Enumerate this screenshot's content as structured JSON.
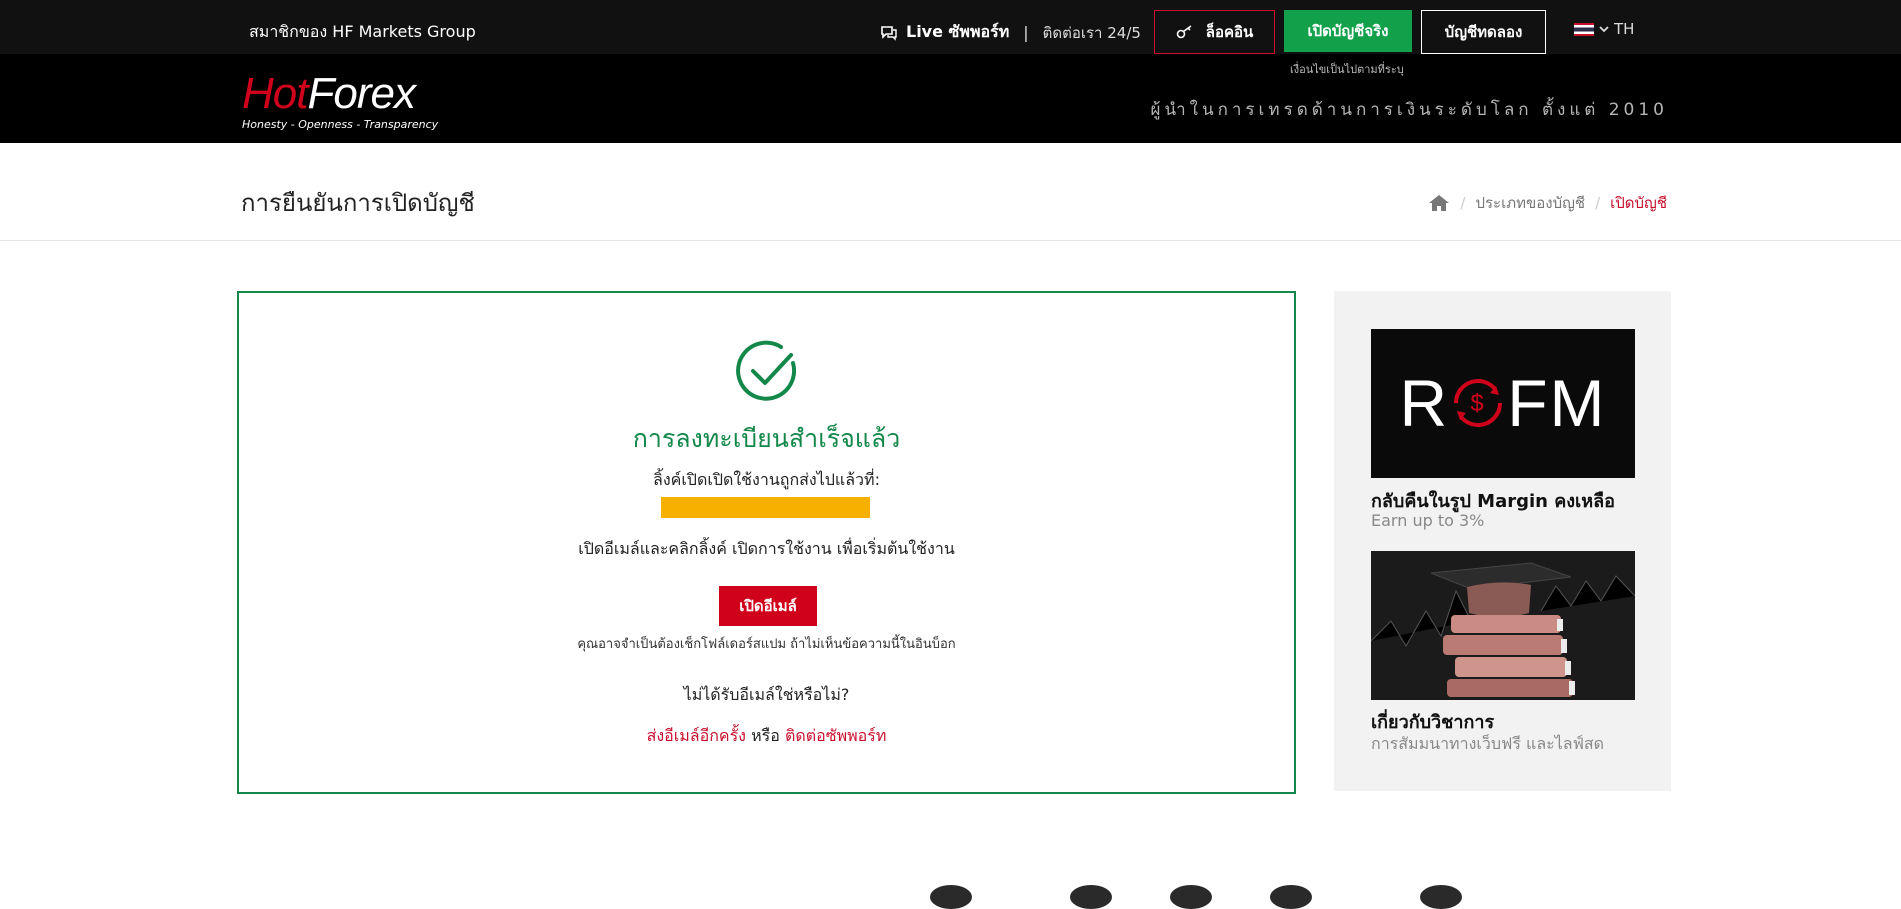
{
  "topbar": {
    "member_text": "สมาชิกของ HF Markets Group",
    "live_label": "Live ซัพพอร์ท",
    "separator": "|",
    "contact_text": "ติดต่อเรา 24/5",
    "login_label": "ล็อคอิน",
    "open_real_label": "เปิดบัญชีจริง",
    "demo_label": "บัญชีทดลอง",
    "lang_label": "TH"
  },
  "brand": {
    "conditions_note": "เงื่อนไขเป็นไปตามที่ระบุ",
    "logo_hot": "Hot",
    "logo_forex": "Forex",
    "logo_tagline": "Honesty - Openness - Transparency",
    "slogan": "ผู้นำในการเทรดด้านการเงินระดับโลก ตั้งแต่ 2010"
  },
  "page": {
    "title": "การยืนยันการเปิดบัญชี",
    "breadcrumb": [
      "ประเภทของบัญชี",
      "เปิดบัญชี"
    ]
  },
  "confirmation": {
    "success_title": "การลงทะเบียนสำเร็จแล้ว",
    "sent_to_text": "ลิ้งค์เปิดเปิดใช้งานถูกส่งไปแล้วที่:",
    "open_instructions": "เปิดอีเมล์และคลิกลิ้งค์ เปิดการใช้งาน เพื่อเริ่มต้นใช้งาน",
    "open_email_label": "เปิดอีเมล์",
    "spam_note": "คุณอาจจำเป็นต้องเช็กโฟล์เดอร์สแปม ถ้าไม่เห็นข้อความนี้ในอินบ็อก",
    "not_received": "ไม่ได้รับอีเมล์ใช่หรือไม่?",
    "resend_label": "ส่งอีเมล์อีกครั้ง",
    "or_text": "หรือ",
    "contact_support_label": "ติดต่อซัพพอร์ท"
  },
  "sidebar": {
    "promos": [
      {
        "image_text_left": "R",
        "image_text_right": "FM",
        "title": "กลับคืนในรูป Margin คงเหลือ",
        "subtitle": "Earn up to 3%"
      },
      {
        "title": "เกี่ยวกับวิชาการ",
        "subtitle": "การสัมมนาทางเว็บฟรี และไลฟ์สด"
      }
    ]
  },
  "colors": {
    "accent_red": "#c8102e",
    "accent_green": "#13884a",
    "button_green": "#12a04a",
    "masked_email": "#f5b000"
  }
}
